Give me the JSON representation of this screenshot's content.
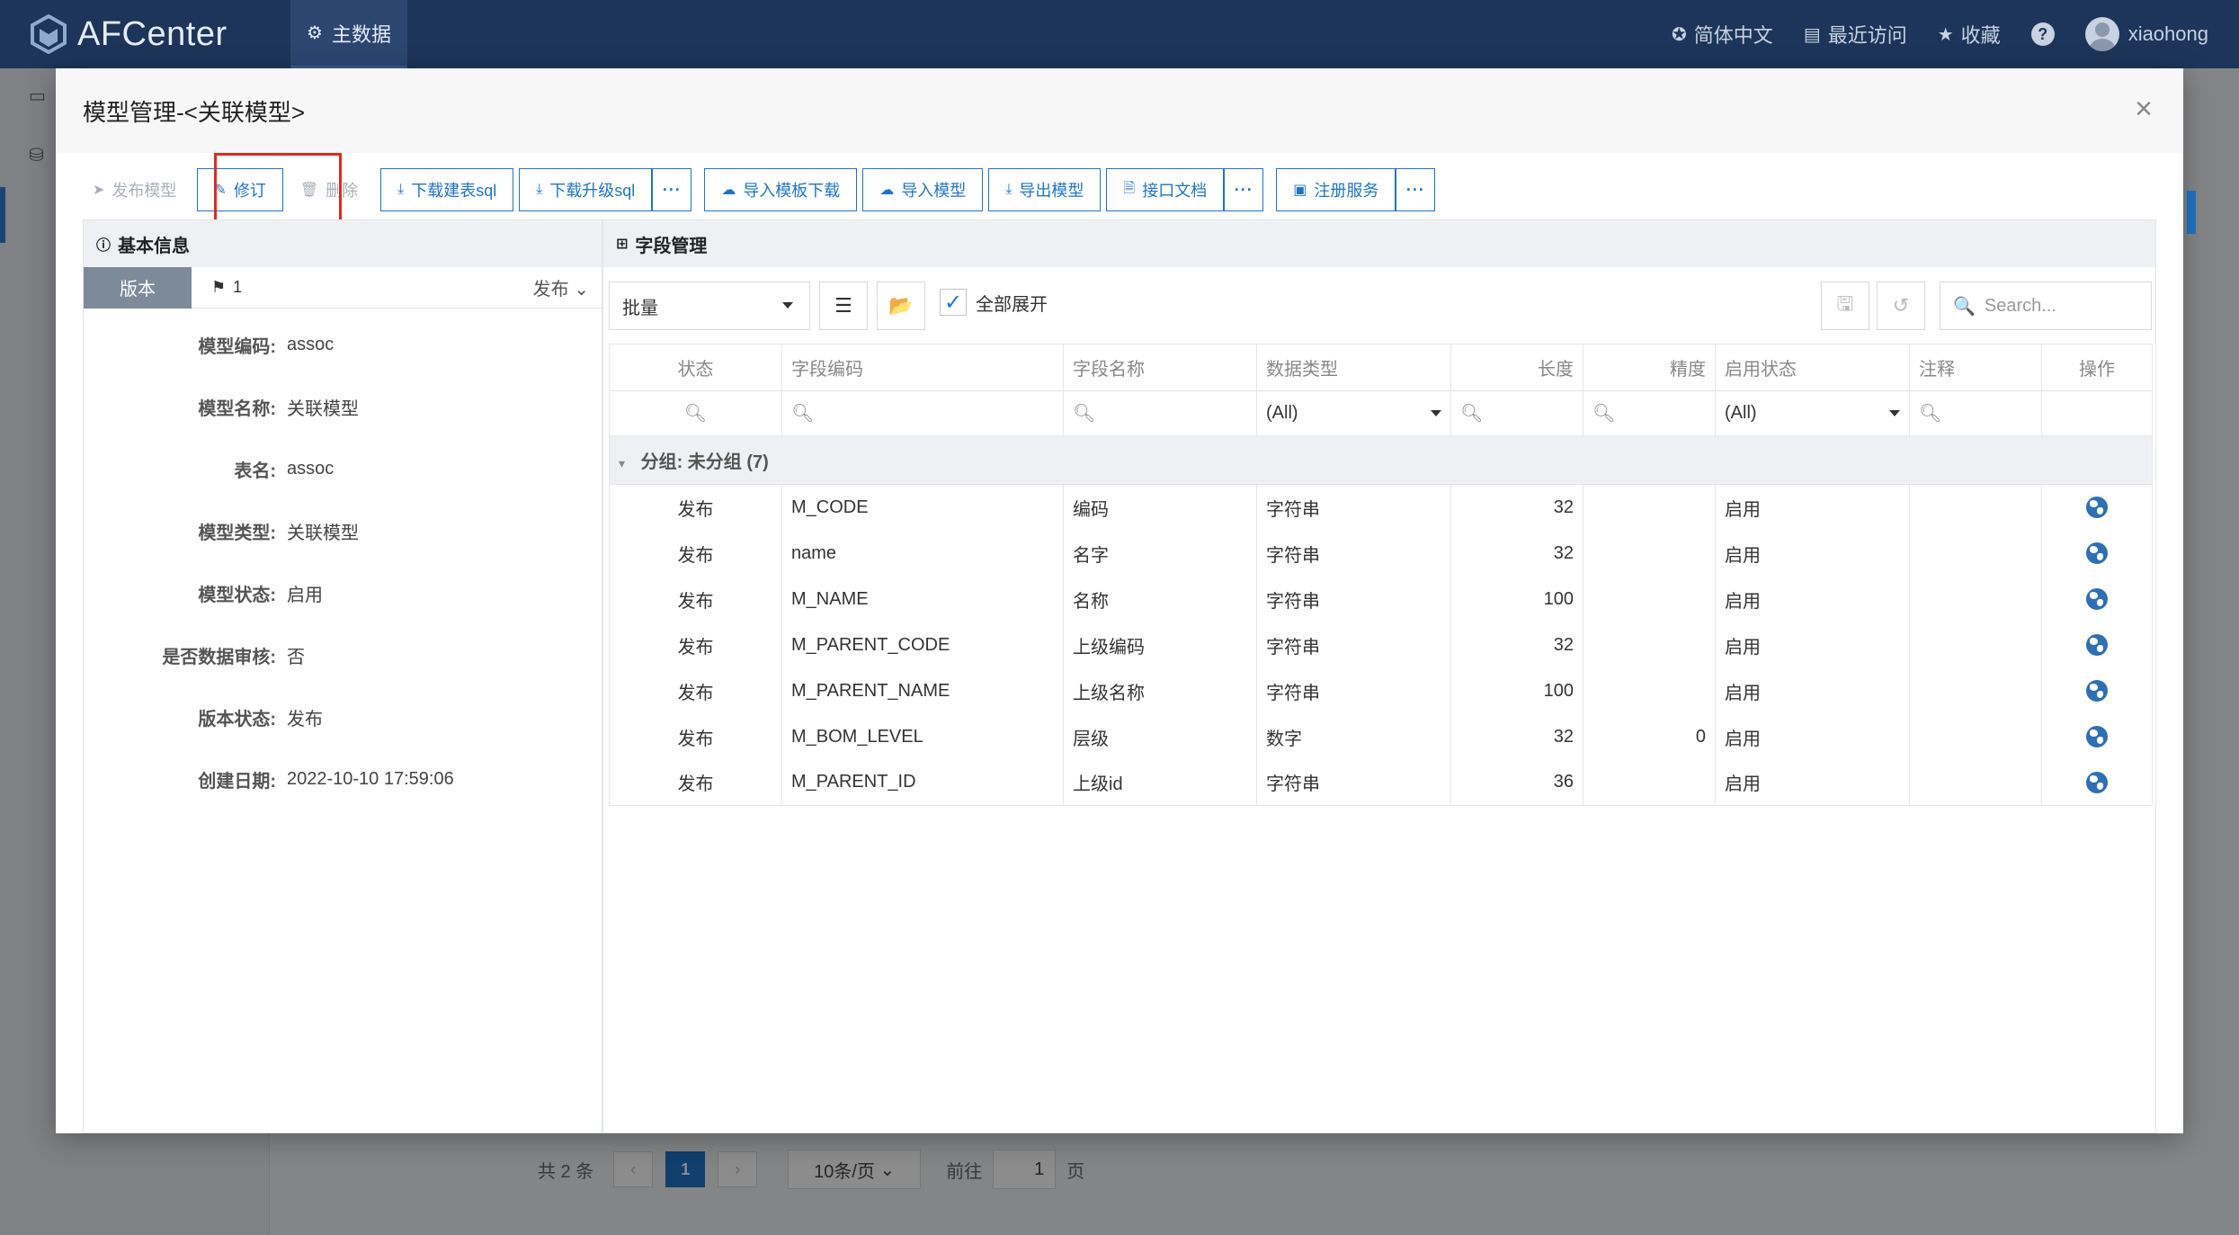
{
  "app": {
    "logo": "AFCenter"
  },
  "topnav": {
    "active_item": "主数据",
    "language": "简体中文",
    "recent": "最近访问",
    "favorites": "收藏",
    "help": "?",
    "username": "xiaohong"
  },
  "background_pagination": {
    "total": "共 2 条",
    "prev": "‹",
    "current_page": "1",
    "next": "›",
    "page_size": "10条/页",
    "goto_label": "前往",
    "goto_value": "1",
    "page_unit": "页"
  },
  "modal": {
    "title": "模型管理-<关联模型>",
    "close": "×",
    "toolbar": {
      "publish_model": "发布模型",
      "revise": "修订",
      "delete": "删除",
      "download_create_sql": "下载建表sql",
      "download_upgrade_sql": "下载升级sql",
      "import_template_download": "导入模板下载",
      "import_model": "导入模型",
      "export_model": "导出模型",
      "api_doc": "接口文档",
      "register_service": "注册服务",
      "more": "···"
    },
    "basic_info": {
      "heading": "基本信息",
      "version_tab": "版本",
      "version_number": "1",
      "version_status_select": "发布",
      "fields": [
        {
          "label": "模型编码:",
          "value": "assoc"
        },
        {
          "label": "模型名称:",
          "value": "关联模型"
        },
        {
          "label": "表名:",
          "value": "assoc"
        },
        {
          "label": "模型类型:",
          "value": "关联模型"
        },
        {
          "label": "模型状态:",
          "value": "启用"
        },
        {
          "label": "是否数据审核:",
          "value": "否"
        },
        {
          "label": "版本状态:",
          "value": "发布"
        },
        {
          "label": "创建日期:",
          "value": "2022-10-10 17:59:06"
        }
      ]
    },
    "field_mgmt": {
      "heading": "字段管理",
      "batch_select": "批量",
      "expand_all": "全部展开",
      "search_placeholder": "Search...",
      "columns": [
        "状态",
        "字段编码",
        "字段名称",
        "数据类型",
        "长度",
        "精度",
        "启用状态",
        "注释",
        "操作"
      ],
      "filter_all": "(All)",
      "group_label": "分组: 未分组 (7)",
      "rows": [
        {
          "status": "发布",
          "code": "M_CODE",
          "name": "编码",
          "type": "字符串",
          "length": "32",
          "precision": "",
          "enabled": "启用",
          "comment": ""
        },
        {
          "status": "发布",
          "code": "name",
          "name": "名字",
          "type": "字符串",
          "length": "32",
          "precision": "",
          "enabled": "启用",
          "comment": ""
        },
        {
          "status": "发布",
          "code": "M_NAME",
          "name": "名称",
          "type": "字符串",
          "length": "100",
          "precision": "",
          "enabled": "启用",
          "comment": ""
        },
        {
          "status": "发布",
          "code": "M_PARENT_CODE",
          "name": "上级编码",
          "type": "字符串",
          "length": "32",
          "precision": "",
          "enabled": "启用",
          "comment": ""
        },
        {
          "status": "发布",
          "code": "M_PARENT_NAME",
          "name": "上级名称",
          "type": "字符串",
          "length": "100",
          "precision": "",
          "enabled": "启用",
          "comment": ""
        },
        {
          "status": "发布",
          "code": "M_BOM_LEVEL",
          "name": "层级",
          "type": "数字",
          "length": "32",
          "precision": "0",
          "enabled": "启用",
          "comment": ""
        },
        {
          "status": "发布",
          "code": "M_PARENT_ID",
          "name": "上级id",
          "type": "字符串",
          "length": "36",
          "precision": "",
          "enabled": "启用",
          "comment": ""
        }
      ]
    }
  },
  "colors": {
    "topbar": "#1d355a",
    "primary": "#1f74c8",
    "highlight": "#e8261d"
  }
}
